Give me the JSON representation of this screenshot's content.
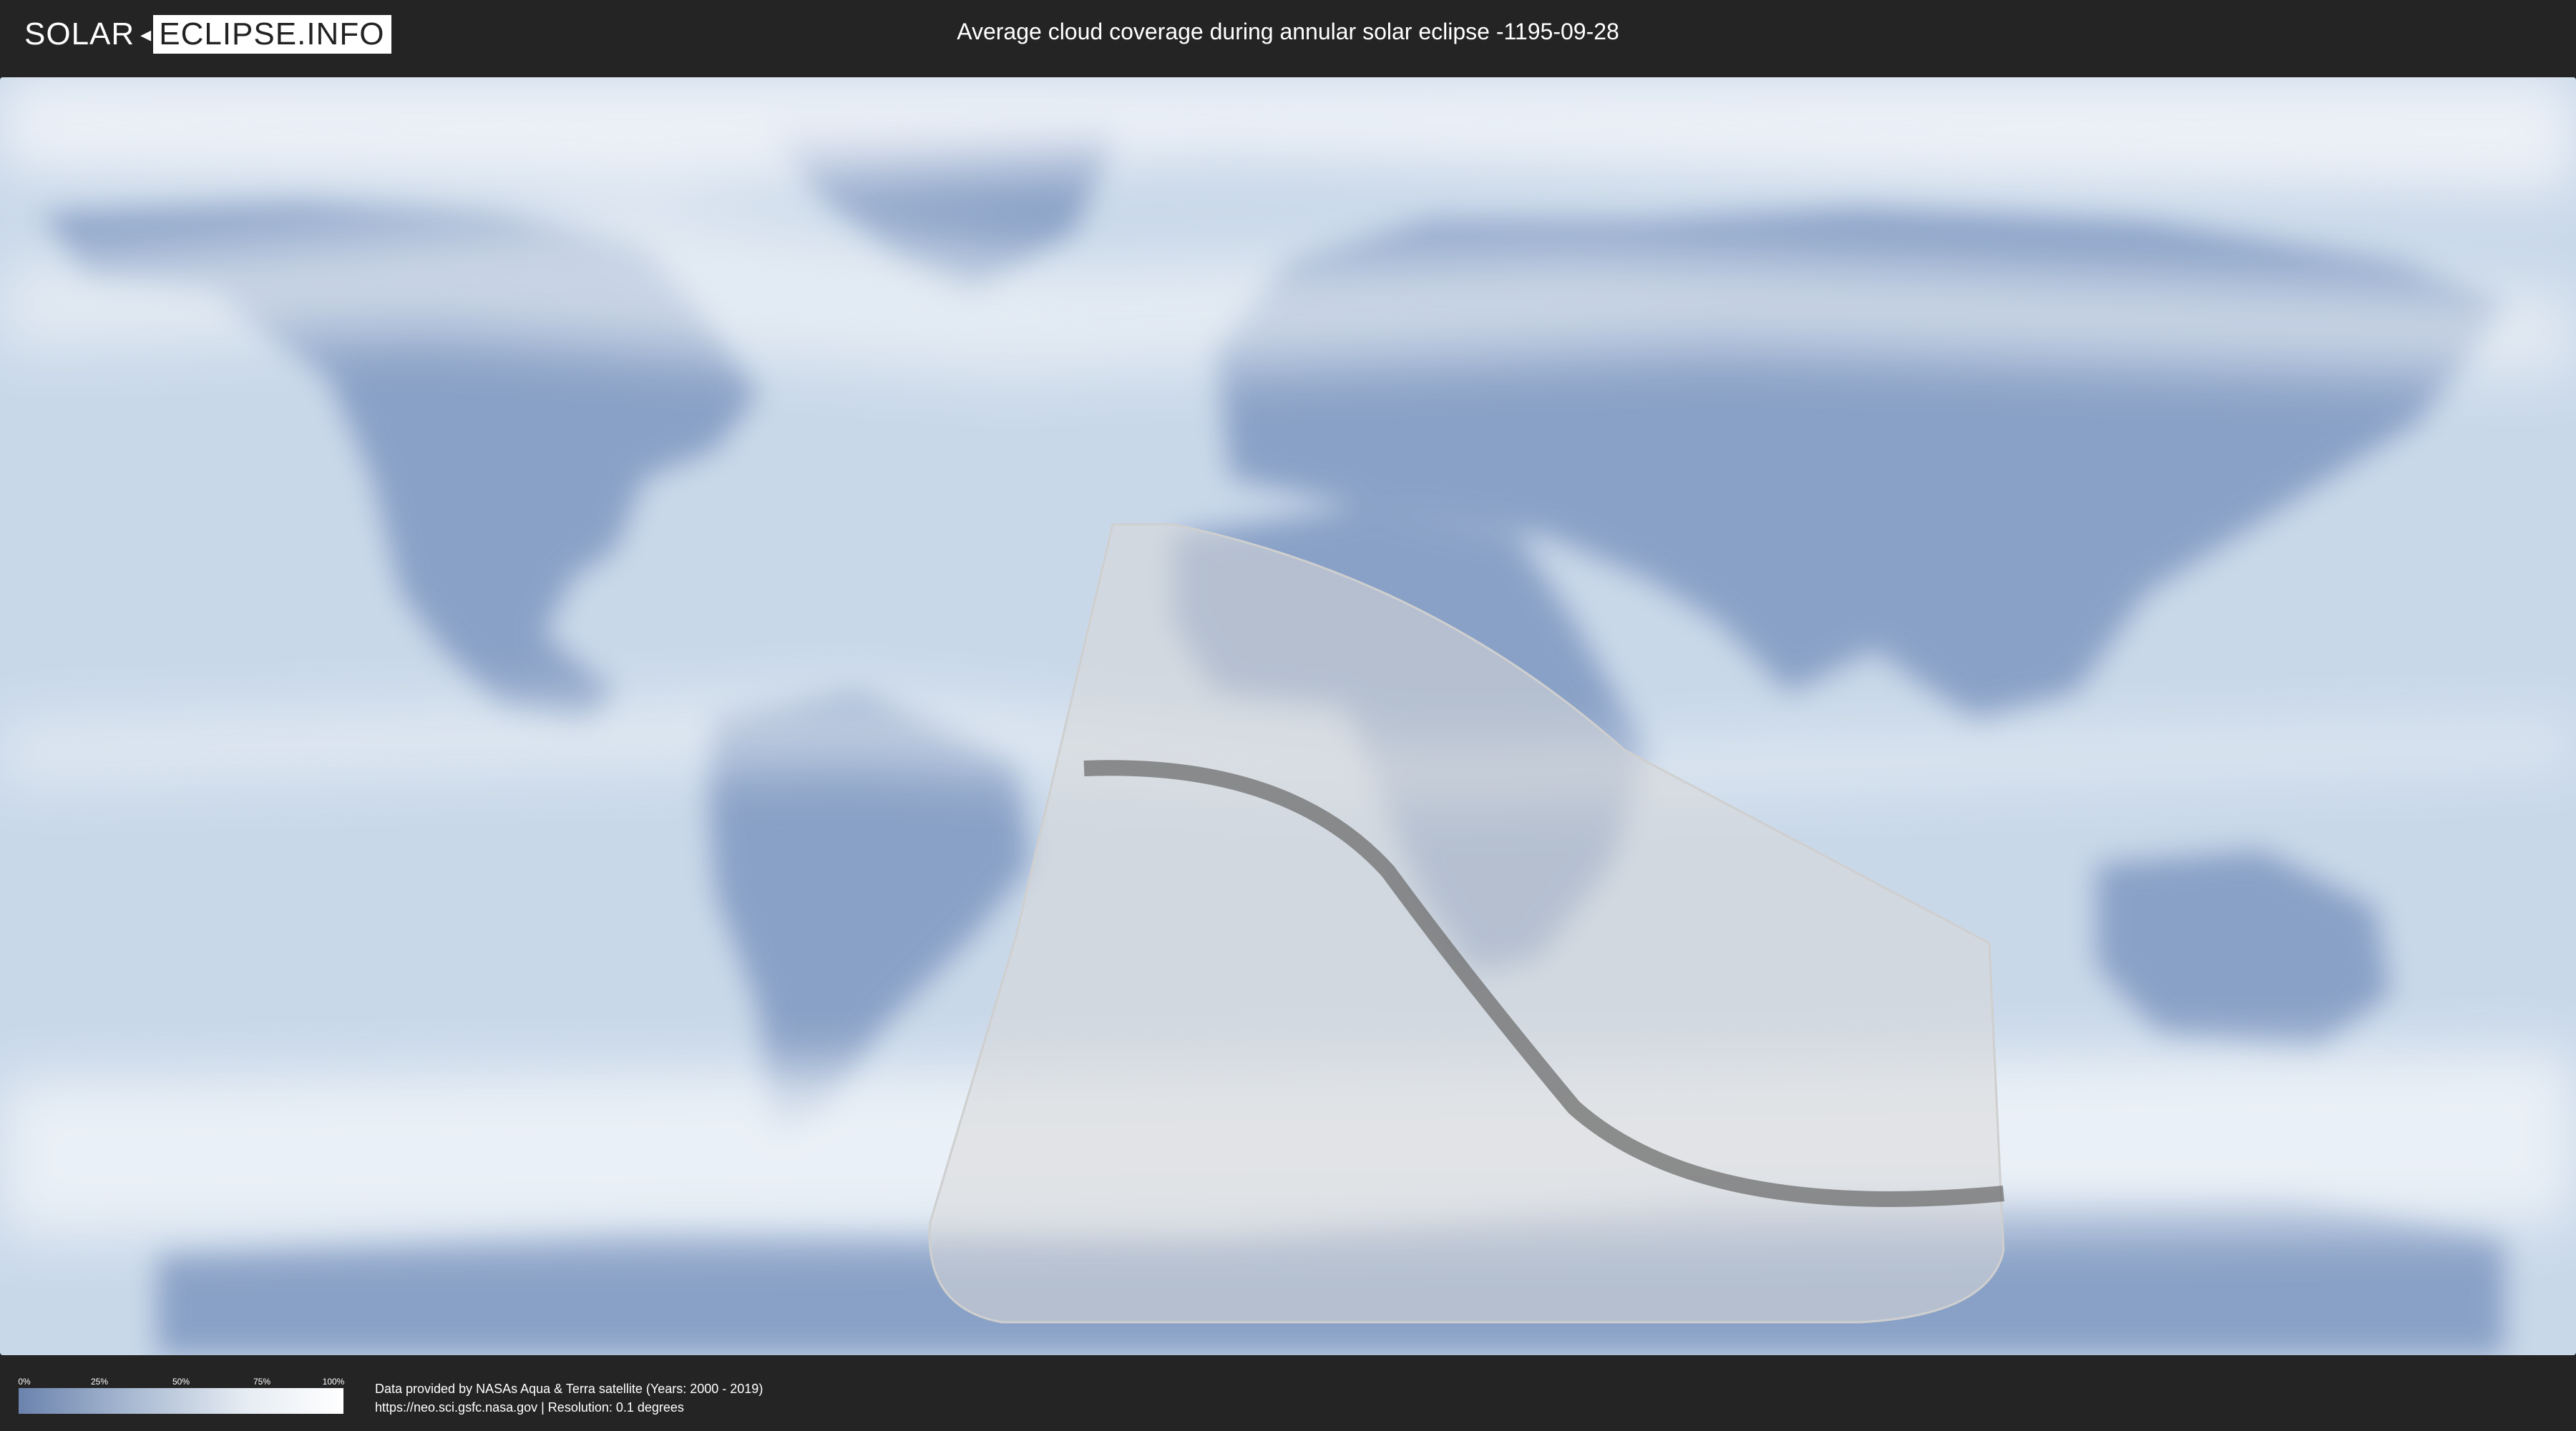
{
  "logo": {
    "part1": "SOLAR",
    "part2": "ECLIPSE.INFO",
    "separator": "◂"
  },
  "title": "Average cloud coverage during annular solar eclipse -1195-09-28",
  "legend": {
    "ticks": [
      "0%",
      "25%",
      "50%",
      "75%",
      "100%"
    ],
    "colors": [
      "#6b83ad",
      "#a9bad2",
      "#e6ecf3",
      "#ffffff"
    ]
  },
  "credits": {
    "line1": "Data provided by NASAs Aqua & Terra satellite (Years: 2000 - 2019)",
    "line2": "https://neo.sci.gsfc.nasa.gov | Resolution: 0.1 degrees"
  },
  "map": {
    "ocean_color": "#c9d8e9",
    "land_color": "#7f98c1",
    "cloud_color": "#f3f6fa",
    "shadow_color": "#d8d8d8",
    "path_color": "#6e6e6e"
  }
}
